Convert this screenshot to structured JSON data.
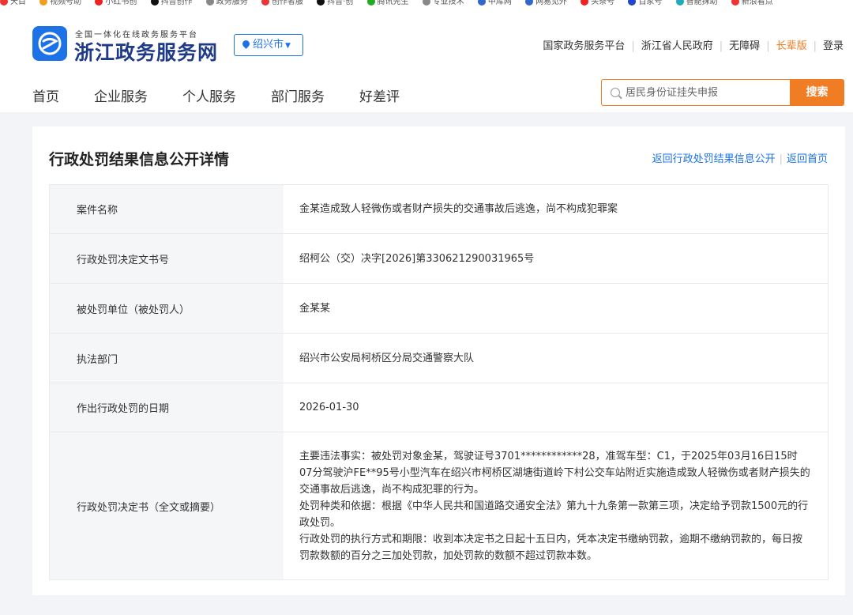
{
  "bookmarks": [
    "天目",
    "视频号助",
    "小红书创",
    "抖音创作",
    "政务服务",
    "创作者服",
    "抖音·创",
    "腾讯先生",
    "专业技术",
    "中库网",
    "网易见外",
    "头条号",
    "百家号",
    "智能抹助",
    "新浪看点"
  ],
  "header": {
    "logo_subtitle": "全国一体化在线政务服务平台",
    "logo_title": "浙江政务服务网",
    "city": "绍兴市",
    "top_links": [
      "国家政务服务平台",
      "浙江省人民政府",
      "无障碍",
      "长辈版",
      "登录"
    ],
    "nav": [
      "首页",
      "企业服务",
      "个人服务",
      "部门服务",
      "好差评"
    ],
    "search_placeholder": "居民身份证挂失申报",
    "search_button": "搜索"
  },
  "detail": {
    "title": "行政处罚结果信息公开详情",
    "links": [
      "返回行政处罚结果信息公开",
      "返回首页"
    ],
    "rows": [
      {
        "label": "案件名称",
        "value": "金某造成致人轻微伤或者财产损失的交通事故后逃逸，尚不构成犯罪案"
      },
      {
        "label": "行政处罚决定文书号",
        "value": "绍柯公（交）决字[2026]第330621290031965号"
      },
      {
        "label": "被处罚单位（被处罚人）",
        "value": "金某某"
      },
      {
        "label": "执法部门",
        "value": "绍兴市公安局柯桥区分局交通警察大队"
      },
      {
        "label": "作出行政处罚的日期",
        "value": "2026-01-30"
      },
      {
        "label": "行政处罚决定书（全文或摘要）",
        "paragraphs": [
          "主要违法事实：被处罚对象金某，驾驶证号3701************28，准驾车型：C1，于2025年03月16日15时07分驾驶沪FE**95号小型汽车在绍兴市柯桥区湖塘街道岭下村公交车站附近实施造成致人轻微伤或者财产损失的交通事故后逃逸，尚不构成犯罪的行为。",
          "处罚种类和依据：根据《中华人民共和国道路交通安全法》第九十九条第一款第三项，决定给予罚款1500元的行政处罚。",
          "行政处罚的执行方式和期限：收到本决定书之日起十五日内，凭本决定书缴纳罚款，逾期不缴纳罚款的，每日按罚款数额的百分之三加处罚款，加处罚款的数额不超过罚款本数。"
        ]
      }
    ]
  }
}
